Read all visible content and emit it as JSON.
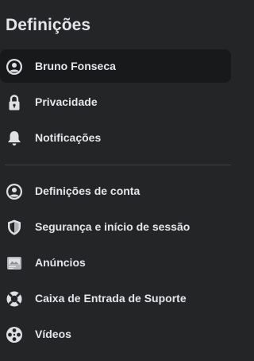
{
  "header": {
    "title": "Definições"
  },
  "menu": {
    "items": [
      {
        "label": "Bruno Fonseca",
        "icon": "user-circle-icon",
        "active": true
      },
      {
        "label": "Privacidade",
        "icon": "lock-icon"
      },
      {
        "label": "Notificações",
        "icon": "bell-icon"
      },
      {
        "label": "Definições de conta",
        "icon": "user-circle-icon"
      },
      {
        "label": "Segurança e início de sessão",
        "icon": "shield-icon"
      },
      {
        "label": "Anúncios",
        "icon": "ads-card-icon"
      },
      {
        "label": "Caixa de Entrada de Suporte",
        "icon": "lifebuoy-icon"
      },
      {
        "label": "Vídeos",
        "icon": "film-reel-icon"
      }
    ]
  },
  "colors": {
    "background": "#242526",
    "active_item_background": "#18191a",
    "text": "#e4e6eb",
    "icon": "#dfe0e4",
    "divider": "#3e4042"
  }
}
